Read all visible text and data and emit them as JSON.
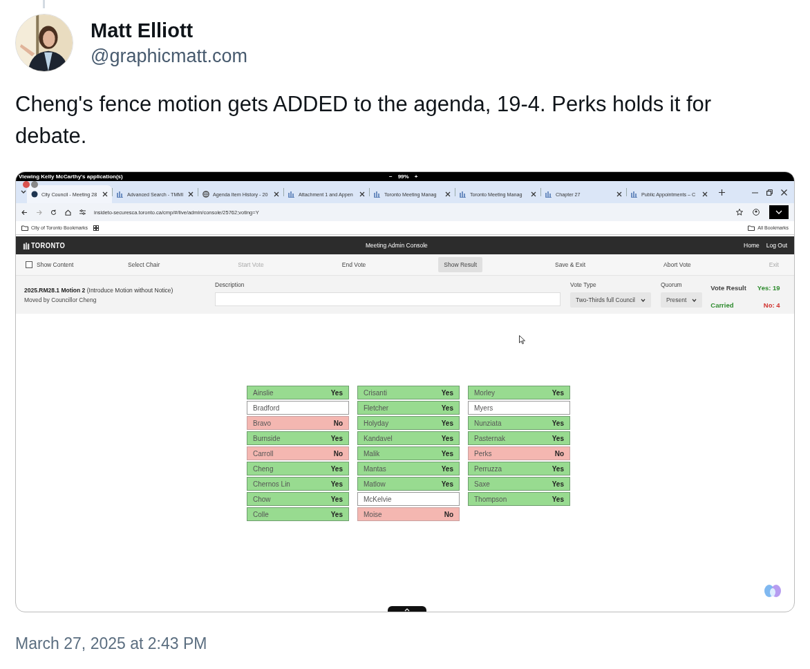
{
  "post": {
    "author": {
      "name": "Matt Elliott",
      "handle": "@graphicmatt.com"
    },
    "text": "Cheng's fence motion gets ADDED to the agenda, 19-4. Perks holds it for debate.",
    "timestamp": "March 27, 2025 at 2:43 PM"
  },
  "screenshot": {
    "banner": {
      "title": "Viewing Kelly McCarthy's application(s)",
      "zoom_out": "−",
      "zoom": "99%",
      "zoom_in": "+"
    },
    "tabs": [
      {
        "label": "City Council - Meeting 28",
        "kind": "site",
        "selected": true
      },
      {
        "label": "Advanced Search - TMMI",
        "kind": "chart",
        "selected": false
      },
      {
        "label": "Agenda Item History - 20",
        "kind": "globe",
        "selected": false
      },
      {
        "label": "Attachment 1 and Appen",
        "kind": "chart",
        "selected": false
      },
      {
        "label": "Toronto Meeting Manag",
        "kind": "chart",
        "selected": false
      },
      {
        "label": "Toronto Meeting Manag",
        "kind": "chart",
        "selected": false
      },
      {
        "label": "Chapter 27",
        "kind": "chart",
        "selected": false
      },
      {
        "label": "Public Appointments – C",
        "kind": "chart",
        "selected": false
      }
    ],
    "address": "insideto-securesca.toronto.ca/cmp/#/live/admin/console/25762;voting=Y",
    "bookmarks": [
      "City of Toronto Bookmarks"
    ],
    "all_bookmarks": "All Bookmarks",
    "app_header": {
      "logo": "TORONTO",
      "title": "Meeting Admin Console",
      "links": [
        "Home",
        "Log Out"
      ]
    },
    "toolbar": {
      "show_content": {
        "label": "Show Content",
        "checked": false
      },
      "buttons": [
        {
          "label": "Select Chair",
          "disabled": false,
          "selected": false
        },
        {
          "label": "Start Vote",
          "disabled": true,
          "selected": false
        },
        {
          "label": "End Vote",
          "disabled": false,
          "selected": false
        },
        {
          "label": "Show Result",
          "disabled": false,
          "selected": true
        },
        {
          "label": "Save & Exit",
          "disabled": false,
          "selected": false
        },
        {
          "label": "Abort Vote",
          "disabled": false,
          "selected": false
        },
        {
          "label": "Exit",
          "disabled": true,
          "selected": false
        }
      ]
    },
    "motion": {
      "title": "**2025.RM28.1 Motion 2** (Introduce Motion without Notice)",
      "mover": "Moved by Councillor Cheng",
      "description_label": "Description",
      "vote_type": {
        "label": "Vote Type",
        "value": "Two-Thirds full Council"
      },
      "quorum": {
        "label": "Quorum",
        "value": "Present"
      },
      "result": {
        "label": "Vote Result",
        "outcome": "Carried",
        "yes": "Yes: 19",
        "no": "No: 4"
      }
    },
    "vote_columns": [
      [
        {
          "name": "Ainslie",
          "kind": "yes",
          "vote": "Yes"
        },
        {
          "name": "Bradford",
          "kind": "absent"
        },
        {
          "name": "Bravo",
          "kind": "no",
          "vote": "No"
        },
        {
          "name": "Burnside",
          "kind": "yes",
          "vote": "Yes"
        },
        {
          "name": "Carroll",
          "kind": "no",
          "vote": "No"
        },
        {
          "name": "Cheng",
          "kind": "yes",
          "vote": "Yes"
        },
        {
          "name": "Chernos Lin",
          "kind": "yes",
          "vote": "Yes"
        },
        {
          "name": "Chow",
          "kind": "yes",
          "vote": "Yes"
        },
        {
          "name": "Colle",
          "kind": "yes",
          "vote": "Yes"
        }
      ],
      [
        {
          "name": "Crisanti",
          "kind": "yes",
          "vote": "Yes"
        },
        {
          "name": "Fletcher",
          "kind": "yes",
          "vote": "Yes"
        },
        {
          "name": "Holyday",
          "kind": "yes",
          "vote": "Yes"
        },
        {
          "name": "Kandavel",
          "kind": "yes",
          "vote": "Yes"
        },
        {
          "name": "Malik",
          "kind": "yes",
          "vote": "Yes"
        },
        {
          "name": "Mantas",
          "kind": "yes",
          "vote": "Yes"
        },
        {
          "name": "Matlow",
          "kind": "yes",
          "vote": "Yes"
        },
        {
          "name": "McKelvie",
          "kind": "absent"
        },
        {
          "name": "Moise",
          "kind": "no",
          "vote": "No"
        }
      ],
      [
        {
          "name": "Morley",
          "kind": "yes",
          "vote": "Yes"
        },
        {
          "name": "Myers",
          "kind": "absent"
        },
        {
          "name": "Nunziata",
          "kind": "yes",
          "vote": "Yes"
        },
        {
          "name": "Pasternak",
          "kind": "yes",
          "vote": "Yes"
        },
        {
          "name": "Perks",
          "kind": "no",
          "vote": "No"
        },
        {
          "name": "Perruzza",
          "kind": "yes",
          "vote": "Yes"
        },
        {
          "name": "Saxe",
          "kind": "yes",
          "vote": "Yes"
        },
        {
          "name": "Thompson",
          "kind": "yes",
          "vote": "Yes"
        }
      ]
    ]
  }
}
